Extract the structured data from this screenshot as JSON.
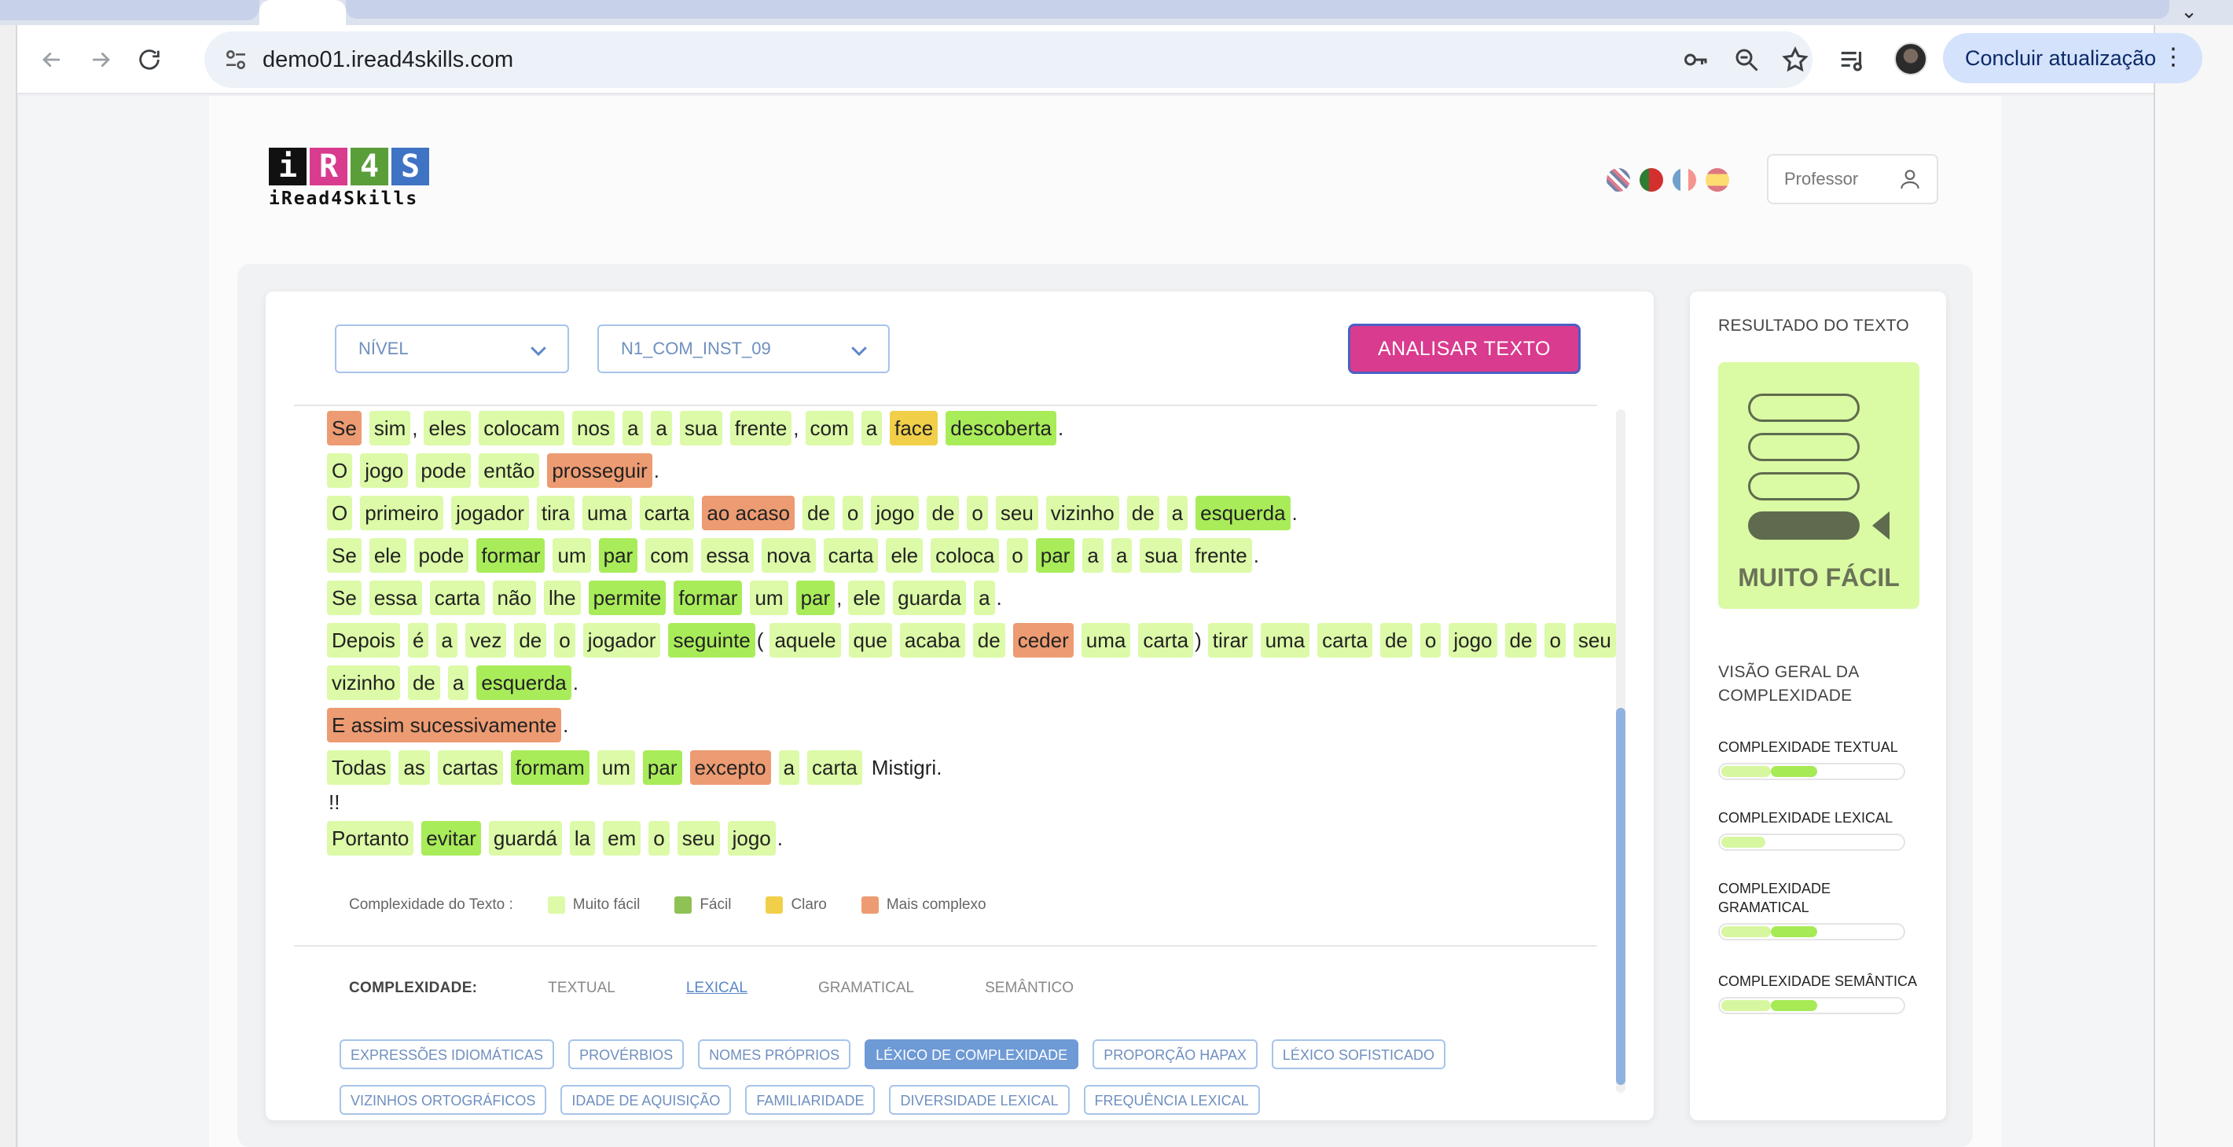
{
  "browser": {
    "url": "demo01.iread4skills.com",
    "update_button": "Concluir atualização",
    "menu_glyph": "⌄"
  },
  "header": {
    "logo_letters": [
      "i",
      "R",
      "4",
      "S"
    ],
    "logo_colors": [
      "#111111",
      "#d93b8e",
      "#5a9e3a",
      "#3f73c4"
    ],
    "logo_tagline": "iRead4Skills",
    "languages": [
      "en",
      "pt",
      "fr",
      "es"
    ],
    "role": "Professor"
  },
  "controls": {
    "level_select": "NÍVEL",
    "text_select": "N1_COM_INST_09",
    "analyze_button": "ANALISAR TEXTO"
  },
  "text_lines": [
    [
      [
        "Se",
        "mc"
      ],
      [
        "sim",
        "vf"
      ],
      [
        ",",
        "p"
      ],
      [
        "eles",
        "vf"
      ],
      [
        "colocam",
        "vf"
      ],
      [
        "nos",
        "vf"
      ],
      [
        "a",
        "vf"
      ],
      [
        "a",
        "vf"
      ],
      [
        "sua",
        "vf"
      ],
      [
        "frente",
        "vf"
      ],
      [
        ",",
        "p"
      ],
      [
        "com",
        "vf"
      ],
      [
        "a",
        "vf"
      ],
      [
        "face",
        "c"
      ],
      [
        "descoberta",
        "f"
      ],
      [
        ".",
        "p"
      ]
    ],
    [
      [
        "O",
        "vf"
      ],
      [
        "jogo",
        "vf"
      ],
      [
        "pode",
        "vf"
      ],
      [
        "então",
        "vf"
      ],
      [
        "prosseguir",
        "mc"
      ],
      [
        ".",
        "p"
      ]
    ],
    [
      [
        "O",
        "vf"
      ],
      [
        "primeiro",
        "vf"
      ],
      [
        "jogador",
        "vf"
      ],
      [
        "tira",
        "vf"
      ],
      [
        "uma",
        "vf"
      ],
      [
        "carta",
        "vf"
      ],
      [
        "ao acaso",
        "mc"
      ],
      [
        "de",
        "vf"
      ],
      [
        "o",
        "vf"
      ],
      [
        "jogo",
        "vf"
      ],
      [
        "de",
        "vf"
      ],
      [
        "o",
        "vf"
      ],
      [
        "seu",
        "vf"
      ],
      [
        "vizinho",
        "vf"
      ],
      [
        "de",
        "vf"
      ],
      [
        "a",
        "vf"
      ],
      [
        "esquerda",
        "f"
      ],
      [
        ".",
        "p"
      ]
    ],
    [
      [
        "Se",
        "vf"
      ],
      [
        "ele",
        "vf"
      ],
      [
        "pode",
        "vf"
      ],
      [
        "formar",
        "f"
      ],
      [
        "um",
        "vf"
      ],
      [
        "par",
        "f"
      ],
      [
        "com",
        "vf"
      ],
      [
        "essa",
        "vf"
      ],
      [
        "nova",
        "vf"
      ],
      [
        "carta",
        "vf"
      ],
      [
        "ele",
        "vf"
      ],
      [
        "coloca",
        "vf"
      ],
      [
        "o",
        "vf"
      ],
      [
        "par",
        "f"
      ],
      [
        "a",
        "vf"
      ],
      [
        "a",
        "vf"
      ],
      [
        "sua",
        "vf"
      ],
      [
        "frente",
        "vf"
      ],
      [
        ".",
        "p"
      ]
    ],
    [
      [
        "Se",
        "vf"
      ],
      [
        "essa",
        "vf"
      ],
      [
        "carta",
        "vf"
      ],
      [
        "não",
        "vf"
      ],
      [
        "lhe",
        "vf"
      ],
      [
        "permite",
        "f"
      ],
      [
        "formar",
        "f"
      ],
      [
        "um",
        "vf"
      ],
      [
        "par",
        "f"
      ],
      [
        ",",
        "p"
      ],
      [
        "ele",
        "vf"
      ],
      [
        "guarda",
        "vf"
      ],
      [
        "a",
        "vf"
      ],
      [
        ".",
        "p"
      ]
    ],
    [
      [
        "Depois",
        "vf"
      ],
      [
        "é",
        "vf"
      ],
      [
        "a",
        "vf"
      ],
      [
        "vez",
        "vf"
      ],
      [
        "de",
        "vf"
      ],
      [
        "o",
        "vf"
      ],
      [
        "jogador",
        "vf"
      ],
      [
        "seguinte",
        "f"
      ],
      [
        "(",
        "p"
      ],
      [
        "aquele",
        "vf"
      ],
      [
        "que",
        "vf"
      ],
      [
        "acaba",
        "vf"
      ],
      [
        "de",
        "vf"
      ],
      [
        "ceder",
        "mc"
      ],
      [
        "uma",
        "vf"
      ],
      [
        "carta",
        "vf"
      ],
      [
        ")",
        "p"
      ],
      [
        "tirar",
        "vf"
      ],
      [
        "uma",
        "vf"
      ],
      [
        "carta",
        "vf"
      ],
      [
        "de",
        "vf"
      ],
      [
        "o",
        "vf"
      ],
      [
        "jogo",
        "vf"
      ],
      [
        "de",
        "vf"
      ],
      [
        "o",
        "vf"
      ],
      [
        "seu",
        "vf"
      ]
    ],
    [
      [
        "vizinho",
        "vf"
      ],
      [
        "de",
        "vf"
      ],
      [
        "a",
        "vf"
      ],
      [
        "esquerda",
        "f"
      ],
      [
        ".",
        "p"
      ]
    ],
    [
      [
        "E assim sucessivamente",
        "mc"
      ],
      [
        ".",
        "p"
      ]
    ],
    [
      [
        "Todas",
        "vf"
      ],
      [
        "as",
        "vf"
      ],
      [
        "cartas",
        "vf"
      ],
      [
        "formam",
        "f"
      ],
      [
        "um",
        "vf"
      ],
      [
        "par",
        "f"
      ],
      [
        "excepto",
        "mc"
      ],
      [
        "a",
        "vf"
      ],
      [
        "carta",
        "vf"
      ],
      [
        "Mistigri.",
        "n"
      ]
    ],
    [
      [
        "!!",
        "n"
      ]
    ],
    [
      [
        "Portanto",
        "vf"
      ],
      [
        "evitar",
        "f"
      ],
      [
        "guardá",
        "vf"
      ],
      [
        "la",
        "vf"
      ],
      [
        "em",
        "vf"
      ],
      [
        "o",
        "vf"
      ],
      [
        "seu",
        "vf"
      ],
      [
        "jogo",
        "vf"
      ],
      [
        ".",
        "p"
      ]
    ]
  ],
  "legend": {
    "title": "Complexidade do Texto :",
    "items": [
      {
        "label": "Muito fácil",
        "color": "#dcfaa7"
      },
      {
        "label": "Fácil",
        "color": "#8fc255"
      },
      {
        "label": "Claro",
        "color": "#f2cf49"
      },
      {
        "label": "Mais complexo",
        "color": "#ed9b72"
      }
    ]
  },
  "complexity_tabs": {
    "label": "COMPLEXIDADE:",
    "tabs": [
      "TEXTUAL",
      "LEXICAL",
      "GRAMATICAL",
      "SEMÂNTICO"
    ],
    "active": "LEXICAL"
  },
  "lexical_filters": {
    "row1": [
      "EXPRESSÕES IDIOMÁTICAS",
      "PROVÉRBIOS",
      "NOMES PRÓPRIOS",
      "LÉXICO DE COMPLEXIDADE",
      "PROPORÇÃO HAPAX",
      "LÉXICO SOFISTICADO"
    ],
    "row2": [
      "VIZINHOS ORTOGRÁFICOS",
      "IDADE DE AQUISIÇÃO",
      "FAMILIARIDADE",
      "DIVERSIDADE LEXICAL",
      "FREQUÊNCIA LEXICAL"
    ],
    "active": "LÉXICO DE COMPLEXIDADE"
  },
  "result": {
    "title": "RESULTADO DO TEXTO",
    "level": "MUITO FÁCIL",
    "overview_title": "VISÃO GERAL DA COMPLEXIDADE",
    "metrics": [
      {
        "label": "COMPLEXIDADE TEXTUAL",
        "light": 0.27,
        "dark_start": 0.27,
        "dark": 0.25
      },
      {
        "label": "COMPLEXIDADE LEXICAL",
        "light": 0.24,
        "dark_start": 0,
        "dark": 0
      },
      {
        "label": "COMPLEXIDADE GRAMATICAL",
        "light": 0.27,
        "dark_start": 0.27,
        "dark": 0.25
      },
      {
        "label": "COMPLEXIDADE SEMÂNTICA",
        "light": 0.27,
        "dark_start": 0.27,
        "dark": 0.25
      }
    ],
    "colors": {
      "light": "#d6f7a0",
      "dark": "#a6ea55"
    }
  }
}
